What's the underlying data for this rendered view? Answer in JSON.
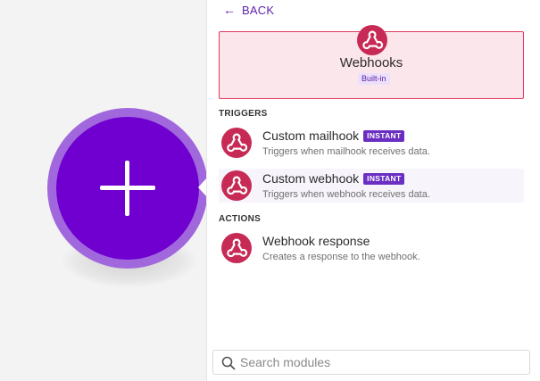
{
  "canvas": {
    "module_color": "#6f00d0",
    "module_ring_color": "#a167dc",
    "add_icon": "plus-icon"
  },
  "panel": {
    "back_label": "BACK",
    "back_icon": "arrow-left-icon",
    "app": {
      "name": "Webhooks",
      "badge": "Built-in",
      "icon": "webhook-icon",
      "accent_color": "#c72a55"
    },
    "sections": {
      "triggers_label": "TRIGGERS",
      "actions_label": "ACTIONS"
    },
    "modules": [
      {
        "title": "Custom mailhook",
        "badge": "INSTANT",
        "description": "Triggers when mailhook receives data."
      },
      {
        "title": "Custom webhook",
        "badge": "INSTANT",
        "description": "Triggers when webhook receives data."
      },
      {
        "title": "Webhook response",
        "description": "Creates a response to the webhook."
      }
    ],
    "search": {
      "placeholder": "Search modules",
      "value": ""
    }
  }
}
